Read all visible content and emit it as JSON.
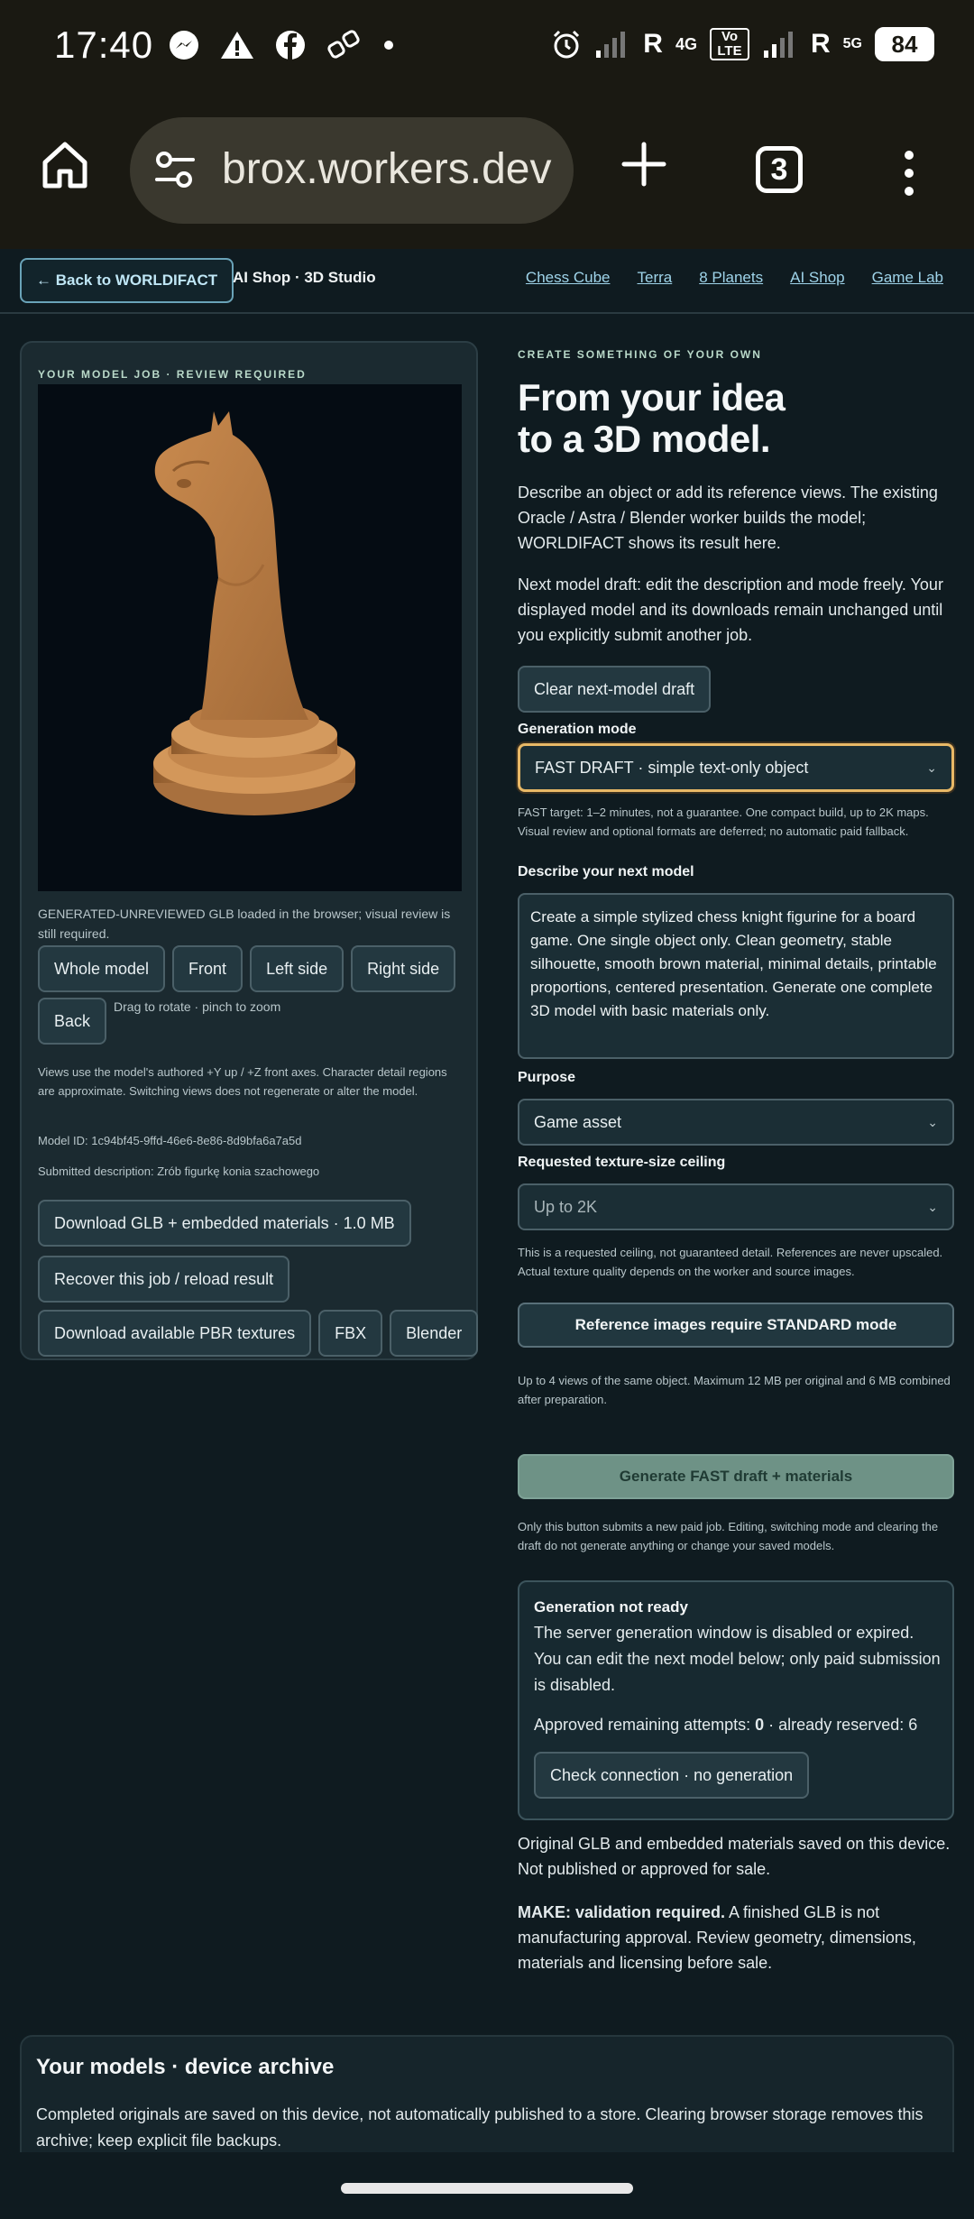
{
  "status_bar": {
    "time": "17:40",
    "network_r1": "R",
    "network_4g": "4G",
    "volte": "Vo LTE",
    "network_r2": "R",
    "network_5g": "5G",
    "battery": "84"
  },
  "browser": {
    "url": "brox.workers.dev",
    "tab_count": "3"
  },
  "nav": {
    "back": "← Back to WORLDIFACT",
    "brand": "AI Shop · 3D Studio",
    "links": [
      "Chess Cube",
      "Terra",
      "8 Planets",
      "AI Shop",
      "Game Lab"
    ]
  },
  "model_job": {
    "eyebrow": "YOUR MODEL JOB · REVIEW REQUIRED",
    "caption": "GENERATED-UNREVIEWED GLB loaded in the browser; visual review is still required.",
    "view_buttons": [
      "Whole model",
      "Front",
      "Left side",
      "Right side",
      "Back"
    ],
    "drag_hint": "Drag to rotate · pinch to zoom",
    "views_note": "Views use the model's authored +Y up / +Z front axes. Character detail regions are approximate. Switching views does not regenerate or alter the model.",
    "model_id": "Model ID: 1c94bf45-9ffd-46e6-8e86-8d9bfa6a7a5d",
    "submitted": "Submitted description: Zrób figurkę konia szachowego",
    "download_glb": "Download GLB + embedded materials · 1.0 MB",
    "recover": "Recover this job / reload result",
    "download_pbr": "Download available PBR textures",
    "fbx": "FBX",
    "blender": "Blender"
  },
  "create": {
    "eyebrow": "CREATE SOMETHING OF YOUR OWN",
    "headline_1": "From your idea",
    "headline_2": "to a 3D model.",
    "intro": "Describe an object or add its reference views. The existing Oracle / Astra / Blender worker builds the model; WORLDIFACT shows its result here.",
    "draft_note": "Next model draft: edit the description and mode freely. Your displayed model and its downloads remain unchanged until you explicitly submit another job.",
    "clear_button": "Clear next-model draft",
    "mode_label": "Generation mode",
    "mode_value": "FAST DRAFT · simple text-only object",
    "mode_note": "FAST target: 1–2 minutes, not a guarantee. One compact build, up to 2K maps. Visual review and optional formats are deferred; no automatic paid fallback.",
    "describe_label": "Describe your next model",
    "description": "Create a simple stylized chess knight figurine for a board game. One single object only. Clean geometry, stable silhouette, smooth brown material, minimal details, printable proportions, centered presentation. Generate one complete 3D model with basic materials only.",
    "purpose_label": "Purpose",
    "purpose_value": "Game asset",
    "texture_label": "Requested texture-size ceiling",
    "texture_value": "Up to 2K",
    "texture_note": "This is a requested ceiling, not guaranteed detail. References are never upscaled. Actual texture quality depends on the worker and source images.",
    "reference_button": "Reference images require STANDARD mode",
    "reference_note": "Up to 4 views of the same object. Maximum 12 MB per original and 6 MB combined after preparation.",
    "generate_button": "Generate FAST draft + materials",
    "generate_note": "Only this button submits a new paid job. Editing, switching mode and clearing the draft do not generate anything or change your saved models."
  },
  "status": {
    "title": "Generation not ready",
    "body": "The server generation window is disabled or expired. You can edit the next model below; only paid submission is disabled.",
    "attempts_prefix": "Approved remaining attempts: ",
    "attempts_value": "0",
    "attempts_suffix": " · already reserved: 6",
    "check_button": "Check connection · no generation"
  },
  "saved_note": "Original GLB and embedded materials saved on this device. Not published or approved for sale.",
  "make": {
    "bold": "MAKE: validation required.",
    "rest": " A finished GLB is not manufacturing approval. Review geometry, dimensions, materials and licensing before sale."
  },
  "archive": {
    "title": "Your models · device archive",
    "text": "Completed originals are saved on this device, not automatically published to a store. Clearing browser storage removes this archive; keep explicit file backups."
  },
  "colors": {
    "accent_focus": "#e8b866",
    "link": "#9fd4ea",
    "generate_button": "#6e9286",
    "model_brown": "#c98a4e"
  }
}
